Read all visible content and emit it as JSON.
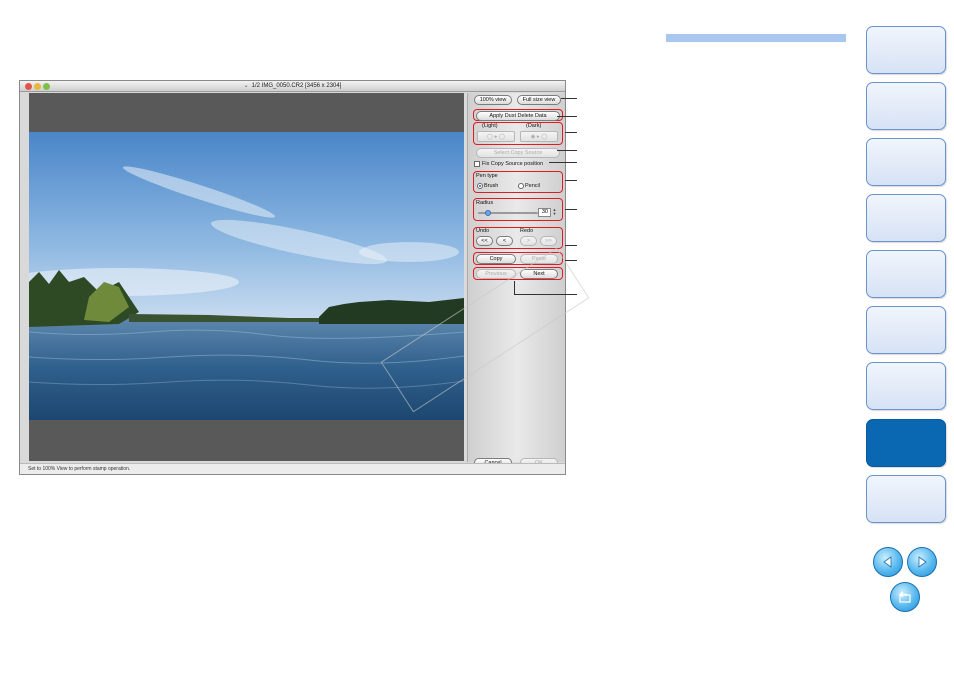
{
  "window": {
    "title": "1/2 IMG_0050.CR2 [3456 x 2304]",
    "status_text": "Set to 100% View to perform stamp operation."
  },
  "panel": {
    "view_100": "100% view",
    "full_size_view": "Full size view",
    "apply_dust_delete": "Apply Dust Delete Data",
    "light_label": "(Light)",
    "dark_label": "(Dark)",
    "select_copy_source": "Select Copy Source",
    "fix_copy_source": "Fix Copy Source position",
    "pen_type_label": "Pen type",
    "brush": "Brush",
    "pencil": "Pencil",
    "radius_label": "Radius",
    "radius_value": "30",
    "undo_label": "Undo",
    "redo_label": "Redo",
    "undo_all": "<<",
    "undo_one": "<",
    "redo_one": ">",
    "redo_all": ">>",
    "copy": "Copy",
    "paste": "Paste",
    "previous": "Previous",
    "next": "Next",
    "cancel": "Cancel",
    "ok": "OK"
  },
  "sidebar": {
    "tab_count": 9,
    "active_tab": 8
  },
  "colors": {
    "accent_blue": "#0a68b3",
    "callout_red": "#e21b22",
    "tab_blue": "#d6e2f5"
  },
  "icons": [
    "previous-page-icon",
    "next-page-icon",
    "return-icon"
  ]
}
